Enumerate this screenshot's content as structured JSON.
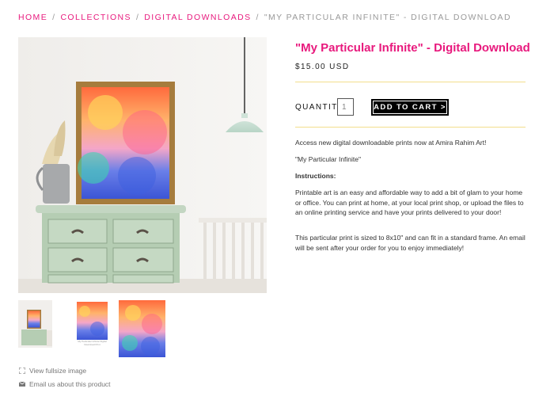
{
  "breadcrumb": {
    "items": [
      "HOME",
      "COLLECTIONS",
      "DIGITAL DOWNLOADS"
    ],
    "separator": "/",
    "current": "\"MY PARTICULAR INFINITE\" - DIGITAL DOWNLOAD"
  },
  "product": {
    "title": "\"My Particular Infinite\" - Digital Download",
    "price": "$15.00 USD"
  },
  "purchase": {
    "quantity_label": "QUANTITY",
    "quantity_value": "1",
    "add_to_cart_label": "ADD TO CART >"
  },
  "description": {
    "intro": "Access new digital downloadable prints now at Amira Rahim Art!",
    "name": "\"My Particular Infinite\"",
    "instructions_heading": "Instructions:",
    "instructions_body": "Printable art is an easy and affordable way to add a bit of glam to your home or office. You can print at home, at your local print shop, or upload the files to an online printing service and have your prints delivered to your door!",
    "size_note": "This particular print is sized to 8x10\" and can fit in a standard frame. An email will be sent after your order for you to enjoy immediately!"
  },
  "gallery": {
    "thumb2_caption": "My Particular Infinite Digital Download Print"
  },
  "links": {
    "fullsize": "View fullsize image",
    "email": "Email us about this product"
  },
  "colors": {
    "accent": "#e8197d",
    "divider": "#f2de8c",
    "button_bg": "#000000"
  },
  "icons": [
    "expand-icon",
    "envelope-icon",
    "chevron-right-icon"
  ]
}
